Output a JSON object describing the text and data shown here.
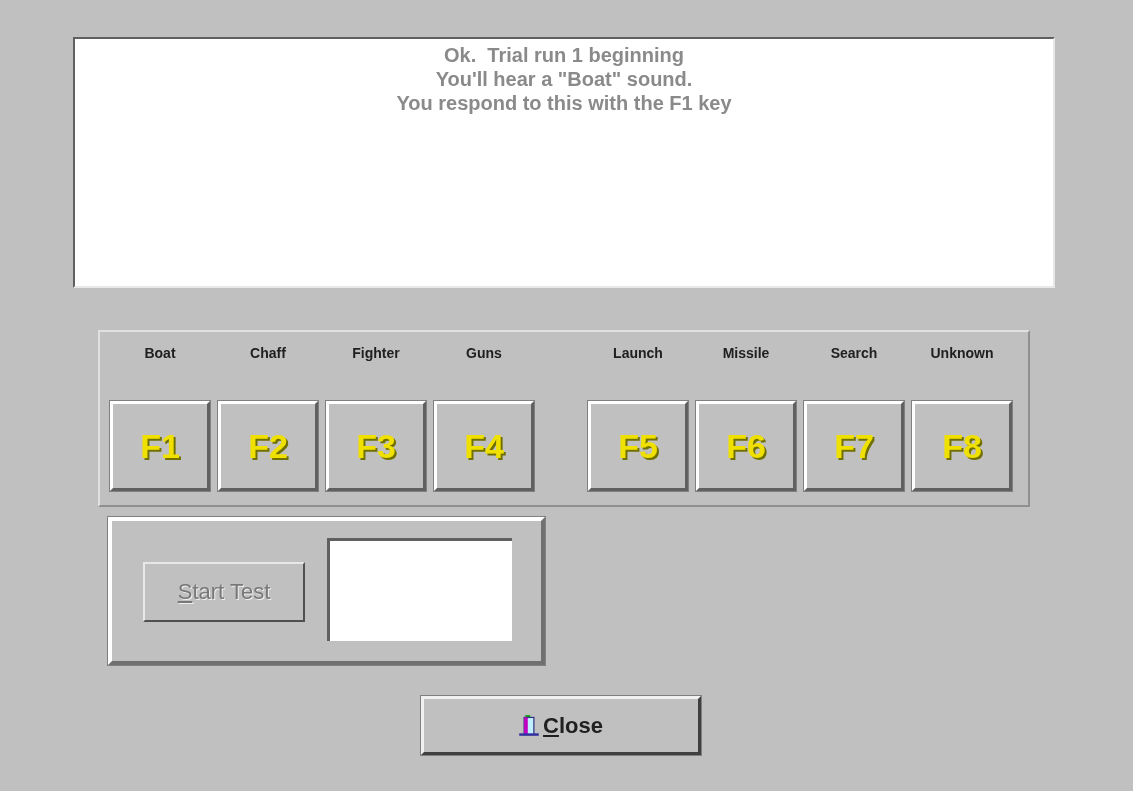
{
  "message": [
    "Ok.  Trial run 1 beginning",
    "You'll hear a \"Boat\" sound.",
    "You respond to this with the F1 key"
  ],
  "key_groups": [
    [
      {
        "label": "Boat",
        "key": "F1"
      },
      {
        "label": "Chaff",
        "key": "F2"
      },
      {
        "label": "Fighter",
        "key": "F3"
      },
      {
        "label": "Guns",
        "key": "F4"
      }
    ],
    [
      {
        "label": "Launch",
        "key": "F5"
      },
      {
        "label": "Missile",
        "key": "F6"
      },
      {
        "label": "Search",
        "key": "F7"
      },
      {
        "label": "Unknown",
        "key": "F8"
      }
    ]
  ],
  "start_button": {
    "label": "Start Test",
    "disabled": true
  },
  "close_button": {
    "label": "Close"
  }
}
